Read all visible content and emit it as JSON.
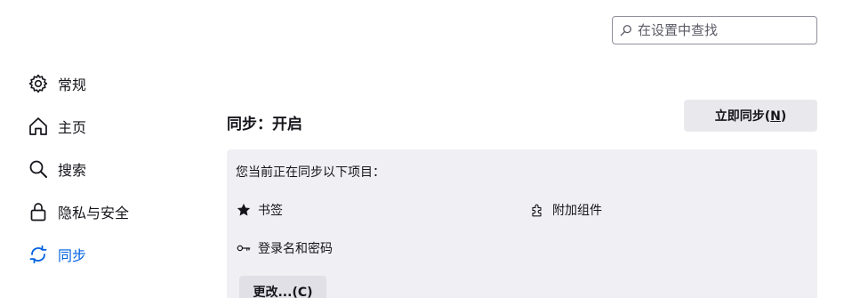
{
  "search": {
    "placeholder": "在设置中查找",
    "icon": "search-icon"
  },
  "sidebar": {
    "items": [
      {
        "label": "常规",
        "icon": "gear-icon"
      },
      {
        "label": "主页",
        "icon": "home-icon"
      },
      {
        "label": "搜索",
        "icon": "search-icon"
      },
      {
        "label": "隐私与安全",
        "icon": "lock-icon"
      },
      {
        "label": "同步",
        "icon": "sync-icon",
        "active": true
      }
    ],
    "active_color": "#0061e0"
  },
  "sync": {
    "title": "同步：开启",
    "sync_now_label": "立即同步(",
    "sync_now_accesskey": "N",
    "sync_now_suffix": ")",
    "intro": "您当前正在同步以下项目：",
    "items": [
      {
        "label": "书签",
        "icon": "star-icon"
      },
      {
        "label": "附加组件",
        "icon": "puzzle-icon"
      },
      {
        "label": "登录名和密码",
        "icon": "key-icon"
      }
    ],
    "change_label": "更改...(C)",
    "panel_color": "#f0f0f4"
  }
}
